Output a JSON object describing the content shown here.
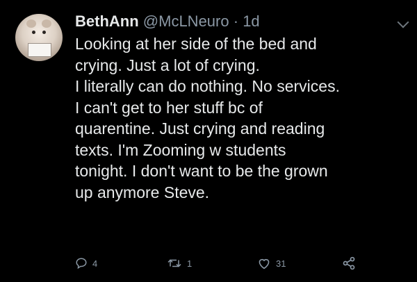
{
  "user": {
    "display_name": "BethAnn",
    "handle": "@McLNeuro",
    "separator": "·",
    "time": "1d",
    "avatar_icon": "hamster-avatar"
  },
  "tweet": {
    "lines": [
      "Looking at her side of the bed and",
      "crying. Just a lot of crying.",
      "I literally can do nothing. No services.",
      "I can't get to her stuff bc of",
      "quarentine. Just crying and reading",
      "texts. I'm Zooming w students",
      "tonight. I don't want to be the grown",
      "up anymore Steve."
    ]
  },
  "actions": {
    "reply_count": "4",
    "retweet_count": "1",
    "like_count": "31"
  },
  "colors": {
    "background": "#000000",
    "text": "#e7e9ea",
    "muted": "#8b98a5"
  }
}
